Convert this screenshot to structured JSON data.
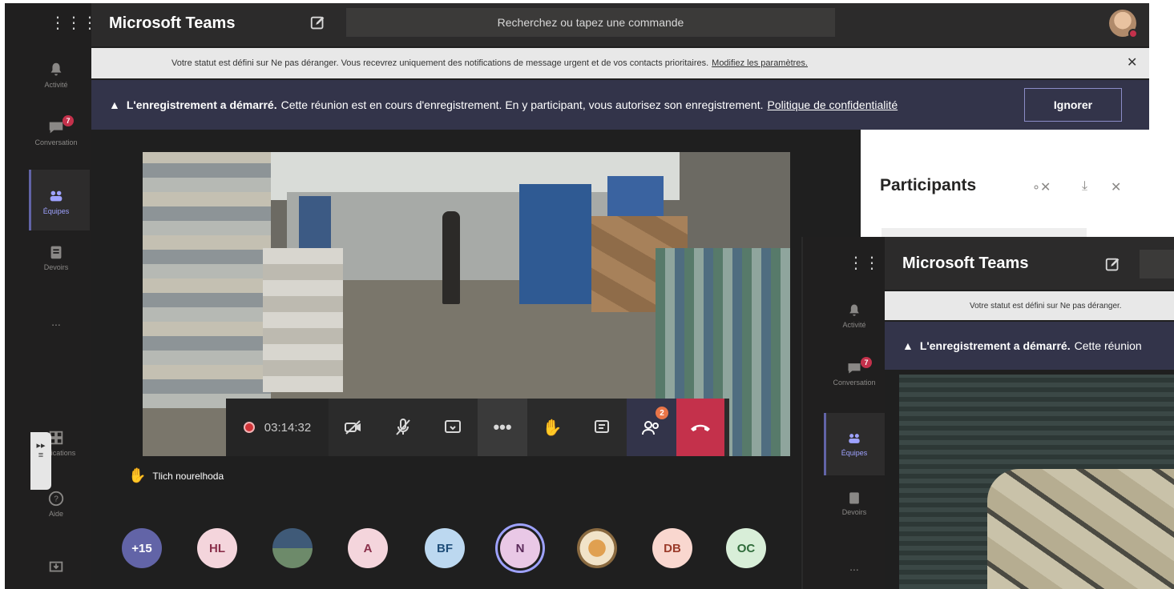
{
  "app_title": "Microsoft Teams",
  "search": {
    "placeholder": "Recherchez ou tapez une commande"
  },
  "rail": [
    {
      "label": "Activité",
      "icon": "bell-icon"
    },
    {
      "label": "Conversation",
      "icon": "chat-icon",
      "badge": "7"
    },
    {
      "label": "Équipes",
      "icon": "teams-icon"
    },
    {
      "label": "Devoirs",
      "icon": "assignments-icon"
    },
    {
      "label": "...",
      "icon": "more-icon"
    },
    {
      "label": "Applications",
      "icon": "apps-icon"
    },
    {
      "label": "Aide",
      "icon": "help-icon"
    }
  ],
  "notification": {
    "text": "Votre statut est défini sur Ne pas déranger. Vous recevrez uniquement des notifications de message urgent et de vos contacts prioritaires.",
    "link": "Modifiez les paramètres."
  },
  "recording_banner": {
    "bold": "L'enregistrement a démarré.",
    "text": "Cette réunion est en cours d'enregistrement. En y participant, vous autorisez son enregistrement.",
    "link": "Politique de confidentialité",
    "button": "Ignorer"
  },
  "call": {
    "timer": "03:14:32",
    "participants_badge": "2",
    "raised_hand_name": "Tlich nourelhoda"
  },
  "participants_row": [
    {
      "initials": "+15",
      "bg": "#6264a7",
      "fg": "#ffffff"
    },
    {
      "initials": "HL",
      "bg": "#f4d5dc",
      "fg": "#8a2f4a"
    },
    {
      "initials": "",
      "bg": "#5d7a96",
      "fg": "#ffffff",
      "photo": true
    },
    {
      "initials": "A",
      "bg": "#f4d5dc",
      "fg": "#8a2f4a"
    },
    {
      "initials": "BF",
      "bg": "#bcd8f0",
      "fg": "#1f4e79"
    },
    {
      "initials": "N",
      "bg": "#e9c8e6",
      "fg": "#5b2a5a",
      "ring": true
    },
    {
      "initials": "",
      "bg": "#d9b27c",
      "fg": "#ffffff",
      "photo": true
    },
    {
      "initials": "DB",
      "bg": "#f9d7cf",
      "fg": "#9b3b2a"
    },
    {
      "initials": "OC",
      "bg": "#d8eed8",
      "fg": "#2f6b3a"
    }
  ],
  "side_panel": {
    "title": "Participants"
  },
  "overlay": {
    "app_title": "Microsoft Teams",
    "notification": "Votre statut est défini sur Ne pas déranger.",
    "rec_bold": "L'enregistrement a démarré.",
    "rec_text": "Cette réunion",
    "rail": [
      {
        "label": "Activité"
      },
      {
        "label": "Conversation",
        "badge": "7"
      },
      {
        "label": "Équipes"
      },
      {
        "label": "Devoirs"
      },
      {
        "label": "..."
      }
    ]
  },
  "colors": {
    "accent": "#6264a7",
    "hangup": "#c4314b",
    "banner": "#33344a",
    "badge": "#e97548"
  }
}
